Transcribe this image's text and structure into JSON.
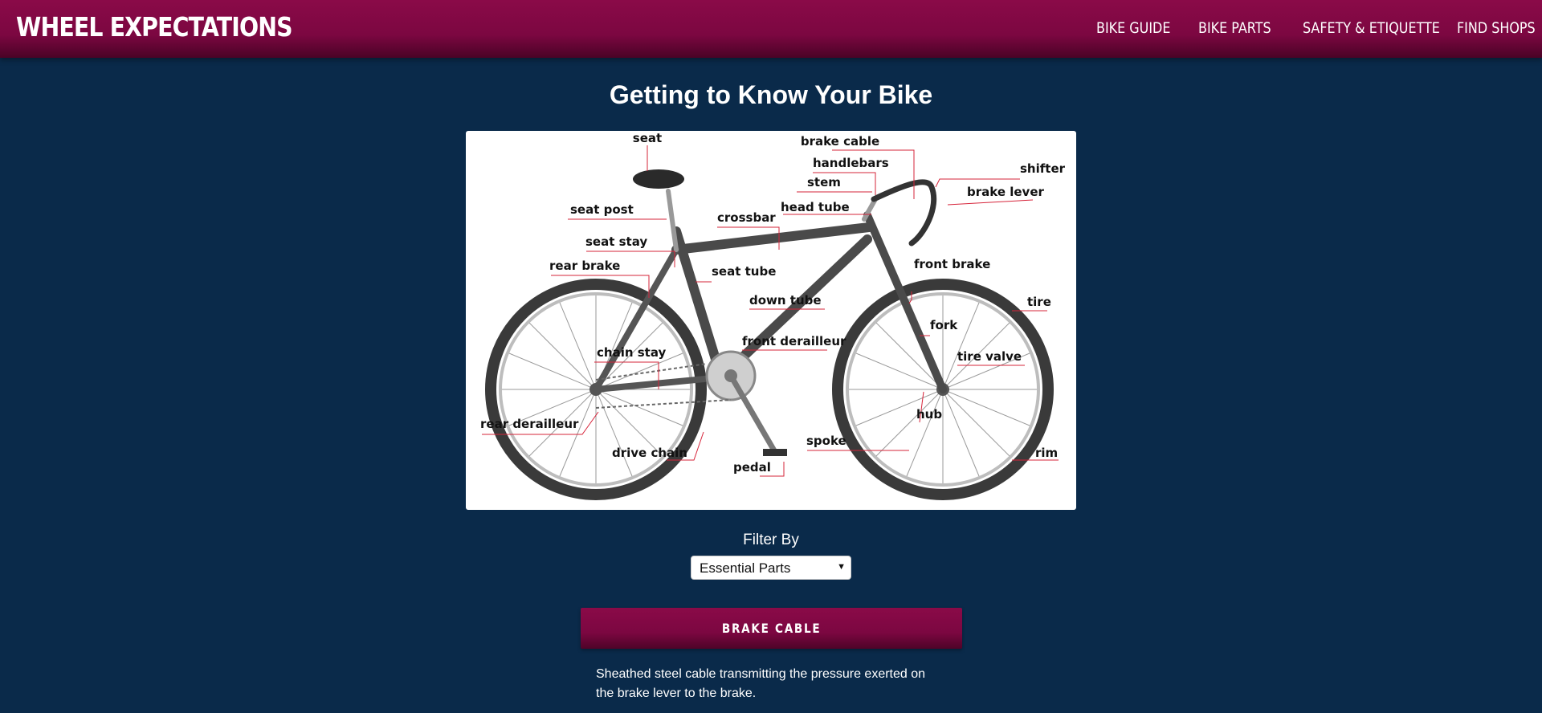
{
  "header": {
    "brand": "WHEEL EXPECTATIONS",
    "nav": [
      "BIKE GUIDE",
      "BIKE PARTS",
      "SAFETY & ETIQUETTE",
      "FIND SHOPS"
    ]
  },
  "main": {
    "title": "Getting to Know Your Bike",
    "diagram_labels": {
      "seat": "seat",
      "brake_cable": "brake cable",
      "handlebars": "handlebars",
      "shifter": "shifter",
      "stem": "stem",
      "brake_lever": "brake lever",
      "seat_post": "seat post",
      "head_tube": "head tube",
      "crossbar": "crossbar",
      "seat_stay": "seat stay",
      "rear_brake": "rear brake",
      "front_brake": "front brake",
      "seat_tube": "seat tube",
      "tire": "tire",
      "down_tube": "down tube",
      "fork": "fork",
      "chain_stay": "chain stay",
      "front_derailleur": "front derailleur",
      "tire_valve": "tire valve",
      "rear_derailleur": "rear derailleur",
      "hub": "hub",
      "spoke": "spoke",
      "drive_chain": "drive chain",
      "rim": "rim",
      "pedal": "pedal"
    },
    "filter": {
      "label": "Filter By",
      "selected": "Essential Parts"
    },
    "part": {
      "name": "BRAKE CABLE",
      "description": "Sheathed steel cable transmitting the pressure exerted on the brake lever to the brake."
    }
  },
  "colors": {
    "background": "#0a2a4a",
    "accent": "#7c0741",
    "leader_lines": "#d6243a"
  }
}
